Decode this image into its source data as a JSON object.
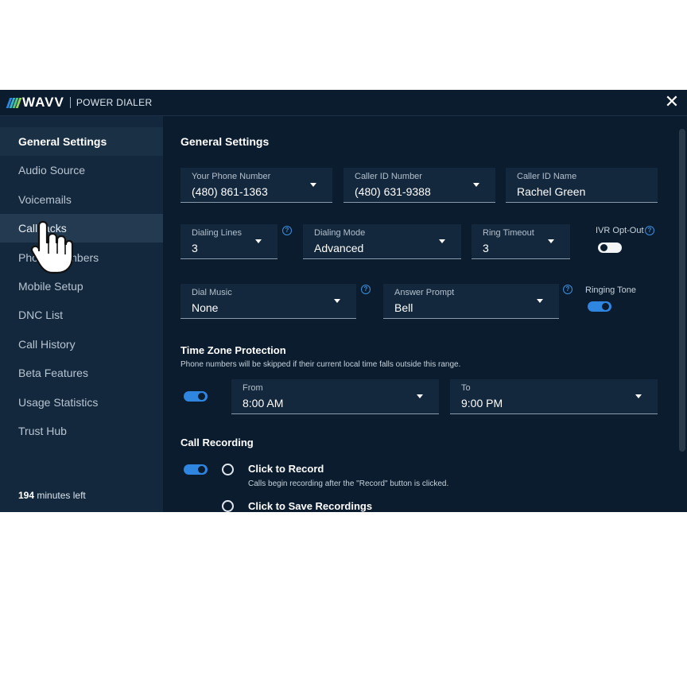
{
  "header": {
    "logo_text": "WAVV",
    "product": "POWER DIALER",
    "close": "✕"
  },
  "sidebar": {
    "items": [
      {
        "label": "General Settings"
      },
      {
        "label": "Audio Source"
      },
      {
        "label": "Voicemails"
      },
      {
        "label": "Callbacks"
      },
      {
        "label": "Phone Numbers"
      },
      {
        "label": "Mobile Setup"
      },
      {
        "label": "DNC List"
      },
      {
        "label": "Call History"
      },
      {
        "label": "Beta Features"
      },
      {
        "label": "Usage Statistics"
      },
      {
        "label": "Trust Hub"
      }
    ],
    "minutes_count": "194",
    "minutes_suffix": "minutes left"
  },
  "general": {
    "title": "General Settings",
    "your_phone": {
      "label": "Your Phone Number",
      "value": "(480) 861-1363"
    },
    "caller_id_number": {
      "label": "Caller ID Number",
      "value": "(480) 631-9388"
    },
    "caller_id_name": {
      "label": "Caller ID Name",
      "value": "Rachel Green"
    },
    "dialing_lines": {
      "label": "Dialing Lines",
      "value": "3"
    },
    "dialing_mode": {
      "label": "Dialing Mode",
      "value": "Advanced"
    },
    "ring_timeout": {
      "label": "Ring Timeout",
      "value": "3"
    },
    "ivr_opt_out": {
      "label": "IVR Opt-Out",
      "enabled": false
    },
    "dial_music": {
      "label": "Dial Music",
      "value": "None"
    },
    "answer_prompt": {
      "label": "Answer Prompt",
      "value": "Bell"
    },
    "ringing_tone": {
      "label": "Ringing Tone",
      "enabled": true
    },
    "help_glyph": "?"
  },
  "timezone": {
    "title": "Time Zone Protection",
    "description": "Phone numbers will be skipped if their current local time falls outside this range.",
    "enabled": true,
    "from": {
      "label": "From",
      "value": "8:00 AM"
    },
    "to": {
      "label": "To",
      "value": "9:00 PM"
    }
  },
  "recording": {
    "title": "Call Recording",
    "enabled": true,
    "options": [
      {
        "label": "Click to Record",
        "description": "Calls begin recording after the \"Record\" button is clicked."
      },
      {
        "label": "Click to Save Recordings"
      }
    ]
  },
  "colors": {
    "accent": "#2f86e0",
    "background": "#0a1c2e",
    "sidebar": "#13283c",
    "logo_stripes": [
      "#2f86e0",
      "#35b6c9",
      "#52c98f",
      "#9bd15b"
    ]
  }
}
